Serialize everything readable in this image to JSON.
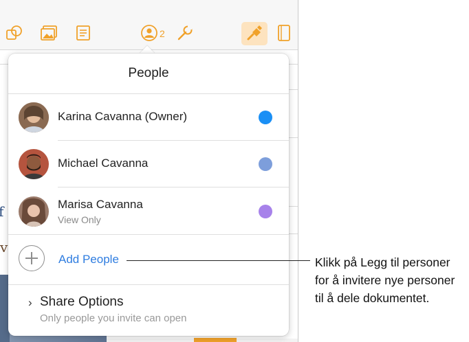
{
  "toolbar": {
    "collaboration_count": "2",
    "icons": [
      "shapes-icon",
      "media-icon",
      "text-icon",
      "collaborate-icon",
      "settings-wrench-icon",
      "format-brush-icon",
      "document-icon"
    ]
  },
  "popover": {
    "title": "People",
    "people": [
      {
        "name": "Karina Cavanna (Owner)",
        "status": "",
        "color": "#1a8ff5"
      },
      {
        "name": "Michael Cavanna",
        "status": "",
        "color": "#7d9edb"
      },
      {
        "name": "Marisa Cavanna",
        "status": "View Only",
        "color": "#a782ea"
      }
    ],
    "add_people_label": "Add People",
    "share_options": {
      "title": "Share Options",
      "subtitle": "Only people you invite can open"
    }
  },
  "callout": {
    "lines": [
      "Klikk på Legg til personer",
      "for å invitere nye personer",
      "til å dele dokumentet."
    ]
  },
  "colors": {
    "accent": "#f0a12a",
    "link": "#2f7de0"
  }
}
